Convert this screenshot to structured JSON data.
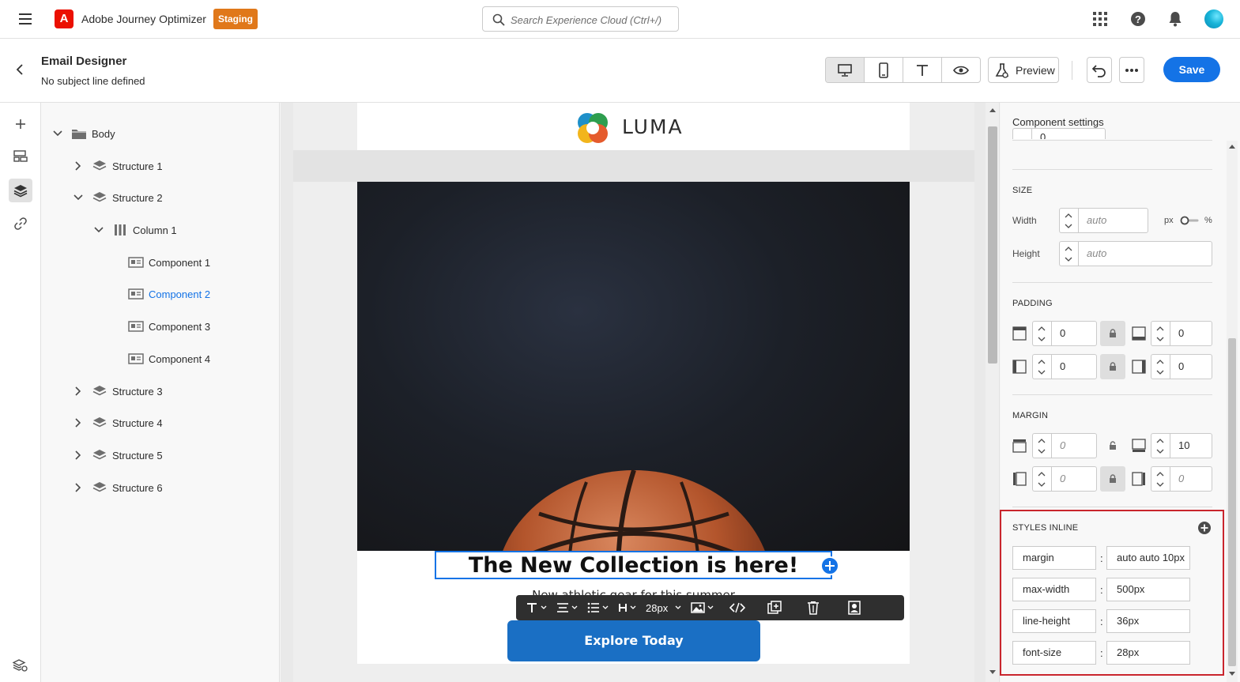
{
  "app": {
    "name": "Adobe Journey Optimizer",
    "environment_badge": "Staging"
  },
  "search": {
    "placeholder": "Search Experience Cloud (Ctrl+/)"
  },
  "header": {
    "title": "Email Designer",
    "subtitle": "No subject line defined",
    "preview_label": "Preview",
    "save_label": "Save",
    "view_modes": [
      "desktop",
      "mobile",
      "text",
      "preview"
    ],
    "active_view": "desktop"
  },
  "tree": {
    "items": [
      {
        "label": "Body",
        "level": 0,
        "expanded": true,
        "type": "folder"
      },
      {
        "label": "Structure 1",
        "level": 1,
        "expanded": false,
        "type": "structure"
      },
      {
        "label": "Structure 2",
        "level": 1,
        "expanded": true,
        "type": "structure"
      },
      {
        "label": "Column 1",
        "level": 2,
        "expanded": true,
        "type": "column"
      },
      {
        "label": "Component 1",
        "level": 3,
        "type": "component"
      },
      {
        "label": "Component 2",
        "level": 3,
        "type": "component",
        "selected": true
      },
      {
        "label": "Component 3",
        "level": 3,
        "type": "component"
      },
      {
        "label": "Component 4",
        "level": 3,
        "type": "component"
      },
      {
        "label": "Structure 3",
        "level": 1,
        "expanded": false,
        "type": "structure"
      },
      {
        "label": "Structure 4",
        "level": 1,
        "expanded": false,
        "type": "structure"
      },
      {
        "label": "Structure 5",
        "level": 1,
        "expanded": false,
        "type": "structure"
      },
      {
        "label": "Structure 6",
        "level": 1,
        "expanded": false,
        "type": "structure"
      }
    ]
  },
  "email": {
    "brand": "LUMA",
    "headline": "The New Collection is here!",
    "subheadline": "New athletic gear for this summer",
    "cta_label": "Explore Today"
  },
  "toolbar": {
    "font_size": "28px"
  },
  "settings": {
    "title": "Component settings",
    "top_value": "0",
    "size": {
      "label": "SIZE",
      "width_label": "Width",
      "width_placeholder": "auto",
      "height_label": "Height",
      "height_placeholder": "auto",
      "unit_px": "px",
      "unit_pct": "%"
    },
    "padding": {
      "label": "PADDING",
      "top": "0",
      "bottom": "0",
      "left": "0",
      "right": "0"
    },
    "margin": {
      "label": "MARGIN",
      "top_placeholder": "0",
      "bottom": "10",
      "left_placeholder": "0",
      "right_placeholder": "0"
    },
    "styles_inline": {
      "label": "STYLES INLINE",
      "rules": [
        {
          "property": "margin",
          "value": "auto auto 10px"
        },
        {
          "property": "max-width",
          "value": "500px"
        },
        {
          "property": "line-height",
          "value": "36px"
        },
        {
          "property": "font-size",
          "value": "28px"
        }
      ]
    }
  },
  "colors": {
    "accent": "#1473e6",
    "badge": "#e0781a",
    "highlight_border": "#c9252d",
    "cta": "#1a6fc4"
  }
}
